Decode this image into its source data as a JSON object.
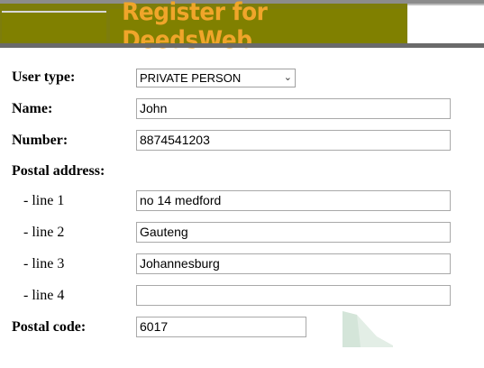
{
  "banner": {
    "title": "Register for DeedsWeb"
  },
  "form": {
    "user_type": {
      "label": "User type:",
      "selected": "PRIVATE PERSON"
    },
    "name": {
      "label": "Name:",
      "value": "John"
    },
    "number": {
      "label": "Number:",
      "value": "8874541203"
    },
    "postal_address": {
      "label": "Postal address:"
    },
    "line1": {
      "label": "- line 1",
      "value": "no 14 medford"
    },
    "line2": {
      "label": "- line 2",
      "value": "Gauteng"
    },
    "line3": {
      "label": "- line 3",
      "value": "Johannesburg"
    },
    "line4": {
      "label": "- line 4",
      "value": ""
    },
    "postal_code": {
      "label": "Postal code:",
      "value": "6017"
    }
  },
  "colors": {
    "banner_olive": "#808000",
    "banner_title": "#f0a52a"
  }
}
